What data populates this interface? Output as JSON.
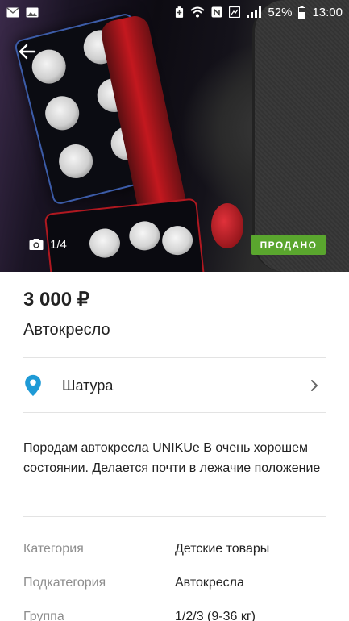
{
  "status_bar": {
    "battery_percent": "52%",
    "time": "13:00"
  },
  "photo": {
    "counter": "1/4",
    "sold_badge": "ПРОДАНО"
  },
  "listing": {
    "price": "3 000 ₽",
    "title": "Автокресло",
    "location": "Шатура",
    "description": "Породам автокресла UNIKUe B очень хорошем состоянии. Делается почти в лежачие положение"
  },
  "params": [
    {
      "label": "Категория",
      "value": "Детские товары"
    },
    {
      "label": "Подкатегория",
      "value": "Автокресла"
    },
    {
      "label": "Группа",
      "value": "1/2/3 (9-36 кг)"
    }
  ],
  "colors": {
    "accent_blue": "#1e9ad6",
    "sold_green": "#5aa62e",
    "muted_text": "#8e8e8e"
  },
  "icons": {
    "back": "arrow-left-icon",
    "camera": "camera-icon",
    "location": "location-pin-icon",
    "chevron": "chevron-right-icon"
  }
}
